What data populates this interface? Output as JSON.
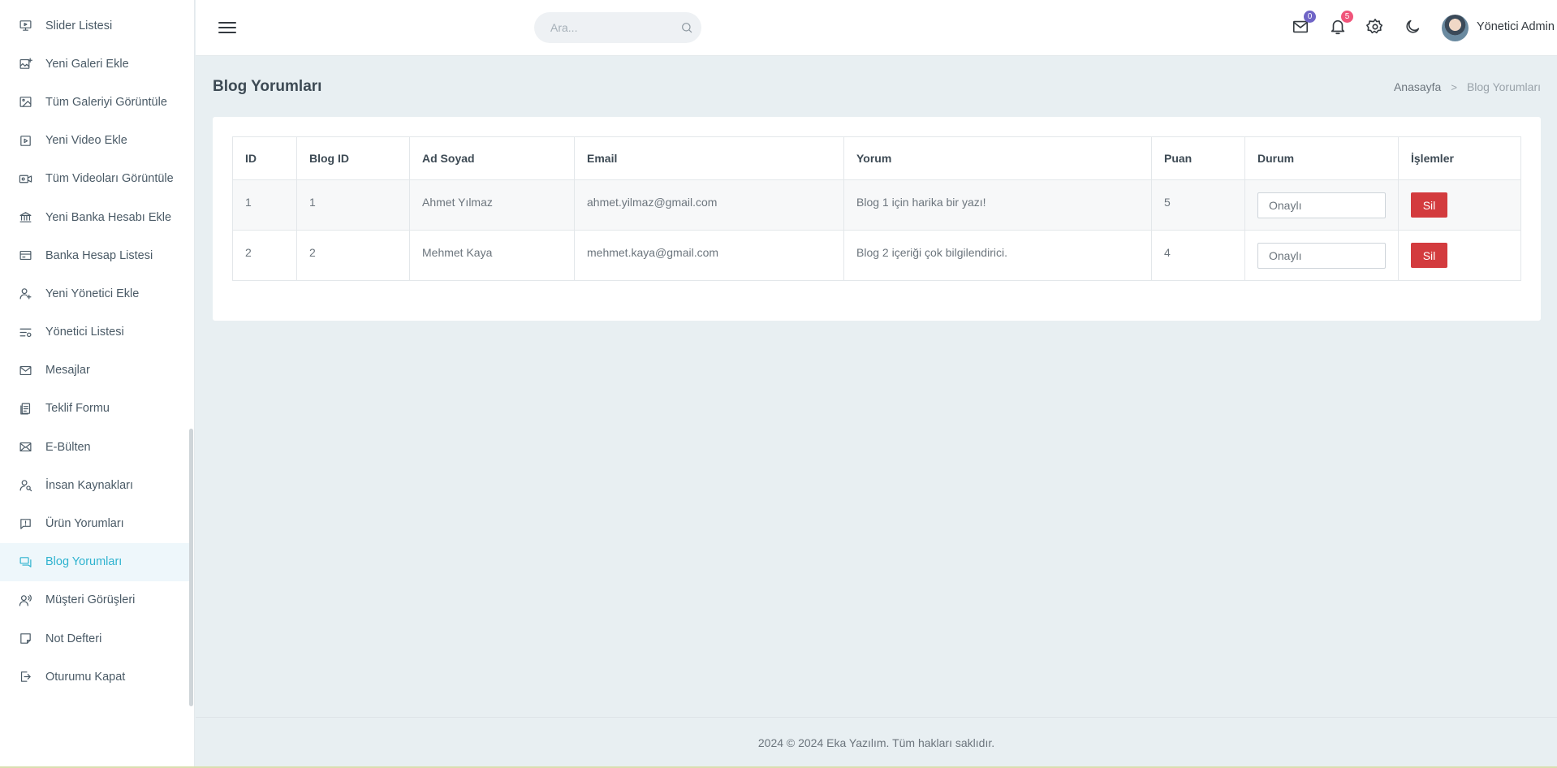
{
  "sidebar": {
    "items": [
      {
        "label": "Slider Listesi",
        "icon": "monitor-icon"
      },
      {
        "label": "Yeni Galeri Ekle",
        "icon": "gallery-add-icon"
      },
      {
        "label": "Tüm Galeriyi Görüntüle",
        "icon": "image-icon"
      },
      {
        "label": "Yeni Video Ekle",
        "icon": "video-add-icon"
      },
      {
        "label": "Tüm Videoları Görüntüle",
        "icon": "video-camera-icon"
      },
      {
        "label": "Yeni Banka Hesabı Ekle",
        "icon": "bank-icon"
      },
      {
        "label": "Banka Hesap Listesi",
        "icon": "credit-card-icon"
      },
      {
        "label": "Yeni Yönetici Ekle",
        "icon": "user-add-icon"
      },
      {
        "label": "Yönetici Listesi",
        "icon": "user-list-icon"
      },
      {
        "label": "Mesajlar",
        "icon": "mail-icon"
      },
      {
        "label": "Teklif Formu",
        "icon": "form-icon"
      },
      {
        "label": "E-Bülten",
        "icon": "mail-open-icon"
      },
      {
        "label": "İnsan Kaynakları",
        "icon": "user-search-icon"
      },
      {
        "label": "Ürün Yorumları",
        "icon": "comment-alert-icon"
      },
      {
        "label": "Blog Yorumları",
        "icon": "comments-icon",
        "active": true
      },
      {
        "label": "Müşteri Görüşleri",
        "icon": "user-voice-icon"
      },
      {
        "label": "Not Defteri",
        "icon": "note-icon"
      },
      {
        "label": "Oturumu Kapat",
        "icon": "logout-icon"
      }
    ]
  },
  "topbar": {
    "search_placeholder": "Ara...",
    "mail_count": "0",
    "notification_count": "5",
    "user_name": "Yönetici Admin",
    "colors": {
      "mail_badge": "#6f64c6",
      "notification_badge": "#f0547a"
    }
  },
  "page": {
    "title": "Blog Yorumları",
    "breadcrumb": {
      "home": "Anasayfa",
      "current": "Blog Yorumları"
    }
  },
  "table": {
    "headers": [
      "ID",
      "Blog ID",
      "Ad Soyad",
      "Email",
      "Yorum",
      "Puan",
      "Durum",
      "İşlemler"
    ],
    "rows": [
      {
        "id": "1",
        "blog_id": "1",
        "name": "Ahmet Yılmaz",
        "email": "ahmet.yilmaz@gmail.com",
        "comment": "Blog 1 için harika bir yazı!",
        "score": "5",
        "status": "Onaylı",
        "action": "Sil"
      },
      {
        "id": "2",
        "blog_id": "2",
        "name": "Mehmet Kaya",
        "email": "mehmet.kaya@gmail.com",
        "comment": "Blog 2 içeriği çok bilgilendirici.",
        "score": "4",
        "status": "Onaylı",
        "action": "Sil"
      }
    ]
  },
  "footer": {
    "text": "2024 © 2024 Eka Yazılım. Tüm hakları saklıdır."
  },
  "colors": {
    "accent": "#2fb3cf",
    "danger": "#d33b3e",
    "background": "#e8eff2"
  }
}
